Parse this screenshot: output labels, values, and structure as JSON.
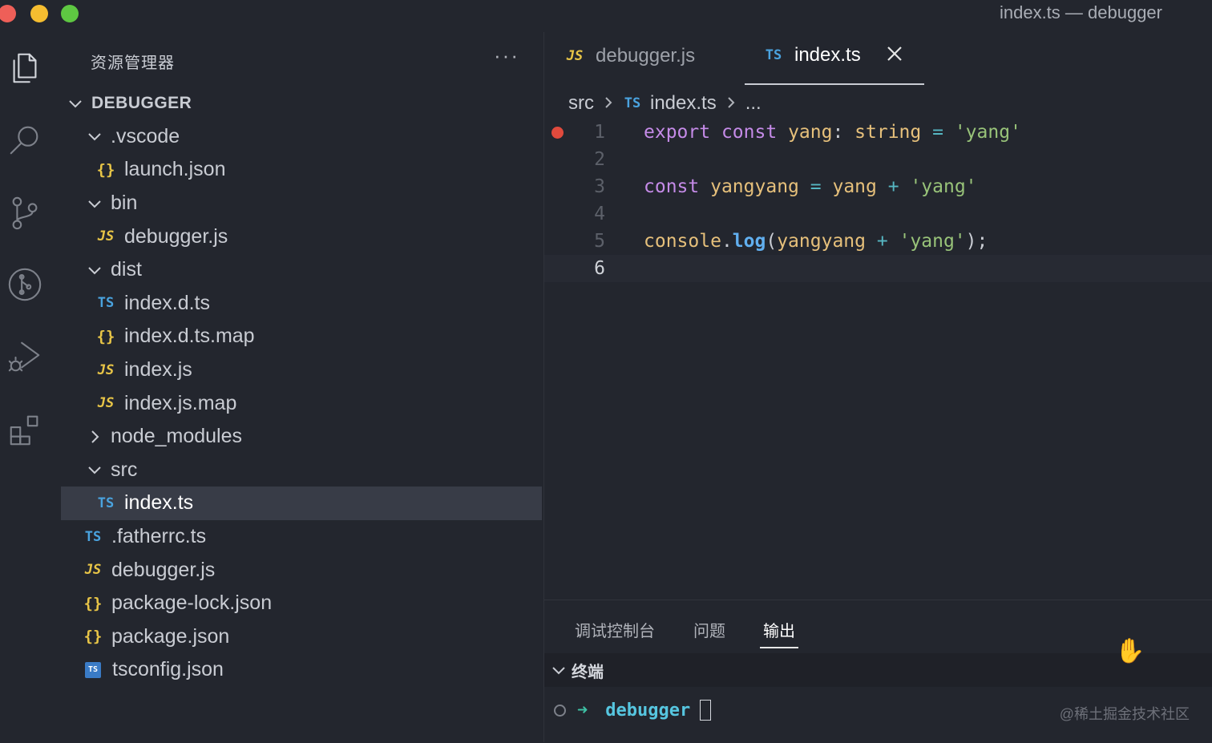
{
  "window": {
    "title": "index.ts — debugger"
  },
  "activity_bar": {
    "items": [
      {
        "name": "explorer",
        "icon": "files-icon",
        "active": true
      },
      {
        "name": "search",
        "icon": "search-icon"
      },
      {
        "name": "source-control",
        "icon": "source-control-icon"
      },
      {
        "name": "git-graph",
        "icon": "git-graph-icon"
      },
      {
        "name": "run-and-debug",
        "icon": "run-debug-icon"
      },
      {
        "name": "extensions",
        "icon": "extensions-icon"
      }
    ]
  },
  "sidebar": {
    "title": "资源管理器",
    "more": "···",
    "root": "DEBUGGER",
    "items": [
      {
        "label": ".vscode",
        "type": "folder",
        "expanded": true,
        "depth": 1
      },
      {
        "label": "launch.json",
        "type": "json",
        "icon": "{}",
        "depth": 2
      },
      {
        "label": "bin",
        "type": "folder",
        "expanded": true,
        "depth": 1
      },
      {
        "label": "debugger.js",
        "type": "js",
        "icon": "JS",
        "depth": 2
      },
      {
        "label": "dist",
        "type": "folder",
        "expanded": true,
        "depth": 1
      },
      {
        "label": "index.d.ts",
        "type": "ts",
        "icon": "TS",
        "depth": 2
      },
      {
        "label": "index.d.ts.map",
        "type": "json",
        "icon": "{}",
        "depth": 2
      },
      {
        "label": "index.js",
        "type": "js",
        "icon": "JS",
        "depth": 2
      },
      {
        "label": "index.js.map",
        "type": "js",
        "icon": "JS",
        "depth": 2
      },
      {
        "label": "node_modules",
        "type": "folder",
        "expanded": false,
        "depth": 1
      },
      {
        "label": "src",
        "type": "folder",
        "expanded": true,
        "depth": 1
      },
      {
        "label": "index.ts",
        "type": "ts",
        "icon": "TS",
        "depth": 2,
        "selected": true
      },
      {
        "label": ".fatherrc.ts",
        "type": "ts",
        "icon": "TS",
        "depth": 1
      },
      {
        "label": "debugger.js",
        "type": "js",
        "icon": "JS",
        "depth": 1
      },
      {
        "label": "package-lock.json",
        "type": "json",
        "icon": "{}",
        "depth": 1
      },
      {
        "label": "package.json",
        "type": "json",
        "icon": "{}",
        "depth": 1
      },
      {
        "label": "tsconfig.json",
        "type": "tsconf",
        "icon": "TS",
        "depth": 1
      }
    ]
  },
  "editor": {
    "tabs": [
      {
        "label": "debugger.js",
        "icon": "JS",
        "active": false
      },
      {
        "label": "index.ts",
        "icon": "TS",
        "active": true
      }
    ],
    "breadcrumb": {
      "folder": "src",
      "file_icon": "TS",
      "file": "index.ts",
      "more": "..."
    },
    "lines": [
      {
        "number": "1",
        "breakpoint": true,
        "tokens": [
          [
            "k",
            "export"
          ],
          [
            "p",
            " "
          ],
          [
            "k",
            "const"
          ],
          [
            "p",
            " "
          ],
          [
            "v",
            "yang"
          ],
          [
            "p",
            ": "
          ],
          [
            "ty",
            "string"
          ],
          [
            "p",
            " "
          ],
          [
            "o",
            "="
          ],
          [
            "p",
            " "
          ],
          [
            "s",
            "'yang'"
          ]
        ]
      },
      {
        "number": "2",
        "tokens": []
      },
      {
        "number": "3",
        "tokens": [
          [
            "k",
            "const"
          ],
          [
            "p",
            " "
          ],
          [
            "v",
            "yangyang"
          ],
          [
            "p",
            " "
          ],
          [
            "o",
            "="
          ],
          [
            "p",
            " "
          ],
          [
            "v",
            "yang"
          ],
          [
            "p",
            " "
          ],
          [
            "o",
            "+"
          ],
          [
            "p",
            " "
          ],
          [
            "s",
            "'yang'"
          ]
        ]
      },
      {
        "number": "4",
        "tokens": []
      },
      {
        "number": "5",
        "tokens": [
          [
            "v",
            "console"
          ],
          [
            "p",
            "."
          ],
          [
            "f",
            "log"
          ],
          [
            "p",
            "("
          ],
          [
            "v",
            "yangyang"
          ],
          [
            "p",
            " "
          ],
          [
            "o",
            "+"
          ],
          [
            "p",
            " "
          ],
          [
            "s",
            "'yang'"
          ],
          [
            "p",
            ");"
          ]
        ]
      },
      {
        "number": "6",
        "current": true,
        "tokens": []
      }
    ]
  },
  "panel": {
    "tabs": [
      {
        "label": "调试控制台",
        "active": false
      },
      {
        "label": "问题",
        "active": false
      },
      {
        "label": "输出",
        "active": true
      }
    ],
    "terminal_label": "终端",
    "prompt_arrow": "➜",
    "prompt_dir": "debugger"
  },
  "watermark": "@稀土掘金技术社区"
}
